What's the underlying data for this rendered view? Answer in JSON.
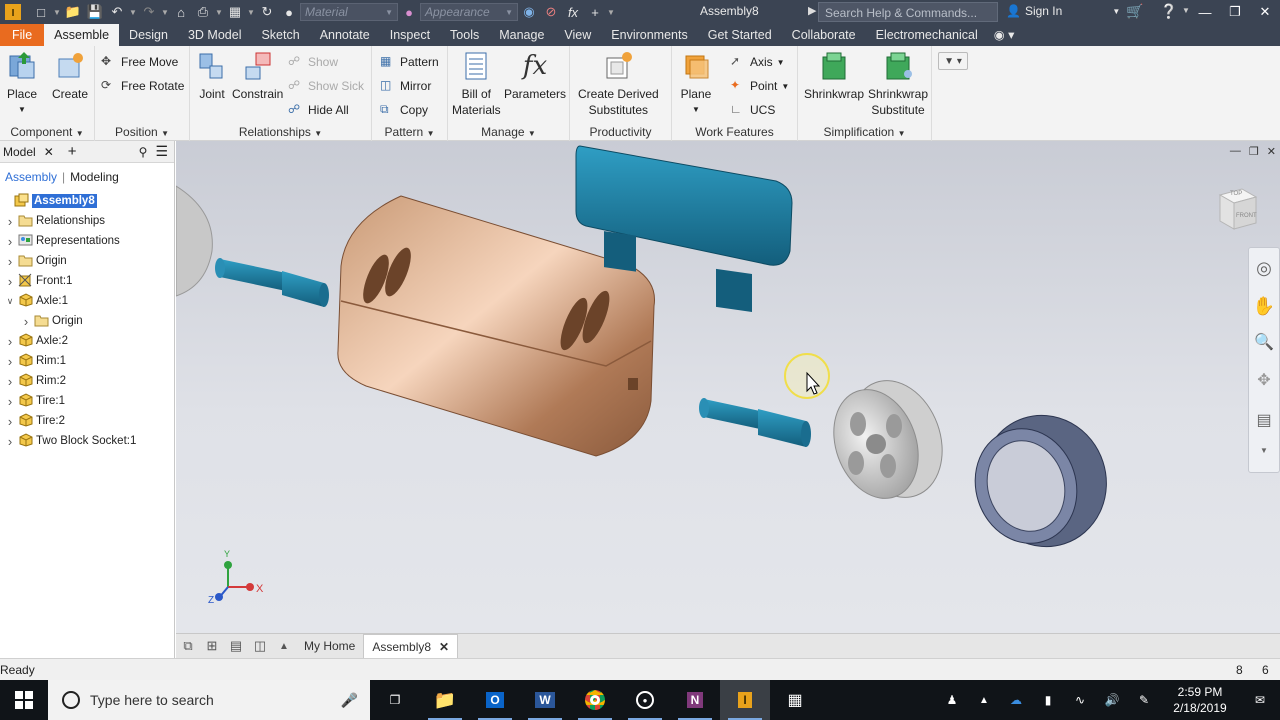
{
  "app": {
    "title": "Assembly8",
    "material_placeholder": "Material",
    "appearance_placeholder": "Appearance",
    "search_placeholder": "Search Help & Commands...",
    "sign_in": "Sign In"
  },
  "menu_tabs": [
    "File",
    "Assemble",
    "Design",
    "3D Model",
    "Sketch",
    "Annotate",
    "Inspect",
    "Tools",
    "Manage",
    "View",
    "Environments",
    "Get Started",
    "Collaborate",
    "Electromechanical"
  ],
  "ribbon": {
    "component": {
      "label": "Component",
      "place": "Place",
      "create": "Create"
    },
    "position": {
      "label": "Position",
      "free_move": "Free Move",
      "free_rotate": "Free Rotate"
    },
    "relationships": {
      "label": "Relationships",
      "joint": "Joint",
      "constrain": "Constrain",
      "show": "Show",
      "show_sick": "Show Sick",
      "hide_all": "Hide All"
    },
    "pattern": {
      "label": "Pattern",
      "pattern": "Pattern",
      "mirror": "Mirror",
      "copy": "Copy"
    },
    "manage": {
      "label": "Manage",
      "bom_line1": "Bill of",
      "bom_line2": "Materials",
      "parameters": "Parameters"
    },
    "productivity": {
      "label": "Productivity",
      "cds_line1": "Create Derived",
      "cds_line2": "Substitutes"
    },
    "work_features": {
      "label": "Work Features",
      "plane": "Plane",
      "axis": "Axis",
      "point": "Point",
      "ucs": "UCS"
    },
    "simplification": {
      "label": "Simplification",
      "shrinkwrap": "Shrinkwrap",
      "sws_line1": "Shrinkwrap",
      "sws_line2": "Substitute"
    }
  },
  "browser": {
    "tab": "Model",
    "mode_assembly": "Assembly",
    "mode_modeling": "Modeling",
    "tree": [
      {
        "label": "Assembly8",
        "level": 0,
        "selected": true,
        "icon": "assembly-icon"
      },
      {
        "label": "Relationships",
        "level": 1,
        "icon": "folder-icon"
      },
      {
        "label": "Representations",
        "level": 1,
        "icon": "representations-icon"
      },
      {
        "label": "Origin",
        "level": 1,
        "icon": "folder-icon"
      },
      {
        "label": "Front:1",
        "level": 1,
        "icon": "part-grounded-icon"
      },
      {
        "label": "Axle:1",
        "level": 1,
        "expanded": true,
        "icon": "part-icon"
      },
      {
        "label": "Origin",
        "level": 2,
        "icon": "folder-icon"
      },
      {
        "label": "Axle:2",
        "level": 1,
        "icon": "part-icon"
      },
      {
        "label": "Rim:1",
        "level": 1,
        "icon": "part-icon"
      },
      {
        "label": "Rim:2",
        "level": 1,
        "icon": "part-icon"
      },
      {
        "label": "Tire:1",
        "level": 1,
        "icon": "part-icon"
      },
      {
        "label": "Tire:2",
        "level": 1,
        "icon": "part-icon"
      },
      {
        "label": "Two Block Socket:1",
        "level": 1,
        "icon": "part-icon"
      }
    ]
  },
  "viewcube": {
    "top": "TOP",
    "front": "FRONT"
  },
  "axis_triad": {
    "x": "X",
    "y": "Y",
    "z": "Z"
  },
  "doc_tabs": {
    "home": "My Home",
    "active": "Assembly8"
  },
  "status": {
    "text": "Ready",
    "count1": "8",
    "count2": "6"
  },
  "taskbar": {
    "search_placeholder": "Type here to search",
    "time": "2:59 PM",
    "date": "2/18/2019"
  },
  "colors": {
    "accent_file": "#e96b1f",
    "titlebar": "#3b4453",
    "part_blue": "#1f7fa3",
    "selection": "#2f6fd6"
  }
}
